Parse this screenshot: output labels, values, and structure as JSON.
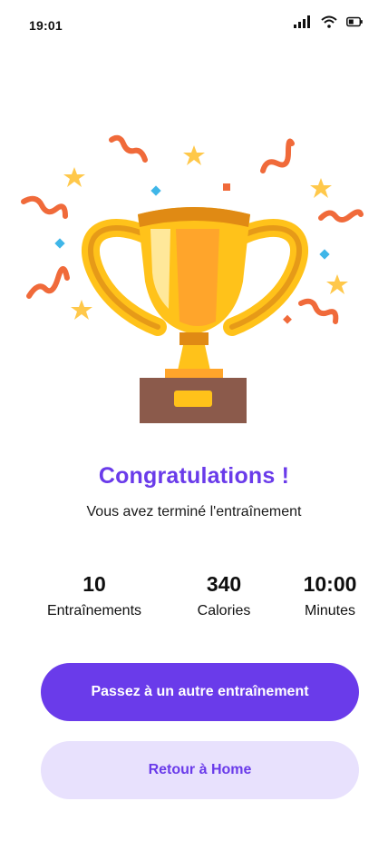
{
  "status_bar": {
    "time": "19:01",
    "icons": [
      "signal-icon",
      "wifi-icon",
      "battery-icon"
    ]
  },
  "illustration": {
    "icon": "trophy-icon"
  },
  "colors": {
    "accent": "#6a3bea",
    "secondary_button_bg": "#e8e1fd",
    "trophy_gold": "#ffc21a",
    "trophy_base": "#8b5a4b",
    "confetti_orange": "#f06a3a",
    "confetti_blue": "#3fb6e8",
    "star_yellow": "#ffc84a"
  },
  "result": {
    "title": "Congratulations !",
    "subtitle": "Vous avez terminé l'entraînement"
  },
  "stats": [
    {
      "value": "10",
      "label": "Entraînements"
    },
    {
      "value": "340",
      "label": "Calories"
    },
    {
      "value": "10:00",
      "label": "Minutes"
    }
  ],
  "actions": {
    "primary_label": "Passez à un autre entraînement",
    "secondary_label": "Retour à Home"
  }
}
